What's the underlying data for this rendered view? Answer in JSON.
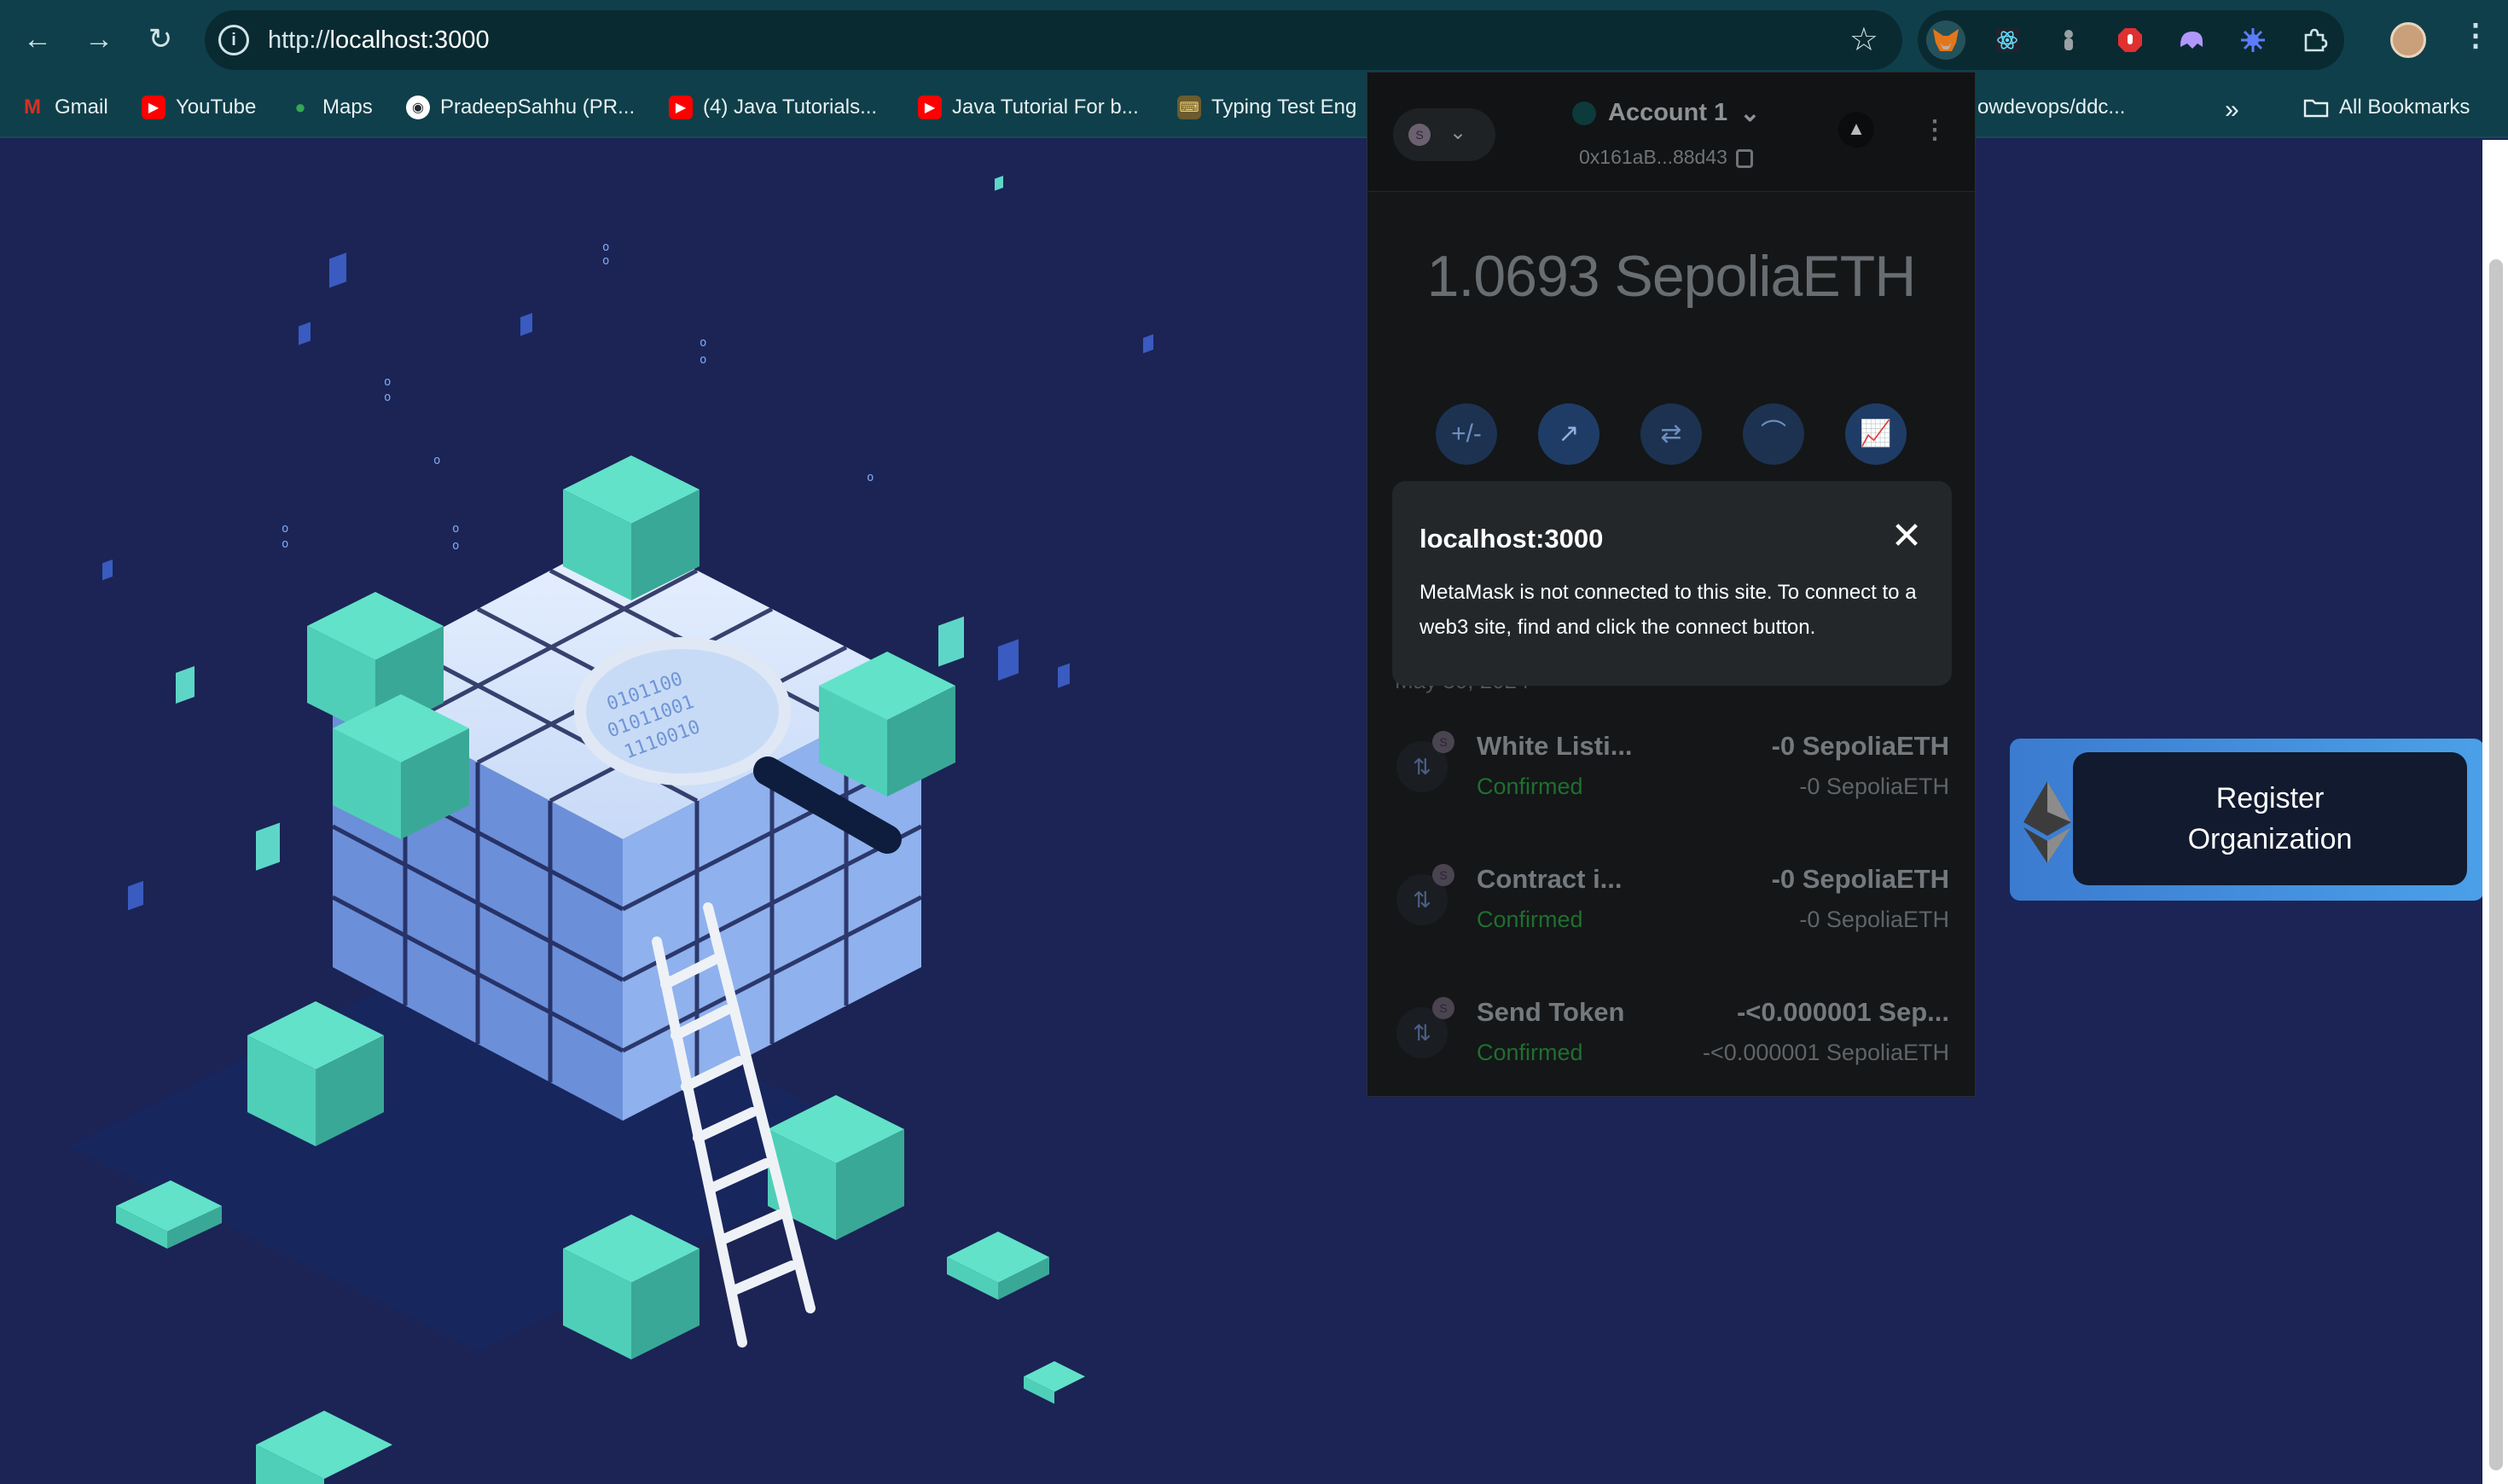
{
  "browser": {
    "url_prefix": "http://",
    "url_host": "localhost:3000",
    "back_icon": "←",
    "forward_icon": "→",
    "reload_icon": "↻",
    "star_icon": "☆",
    "more_icon": "⋮",
    "bookmarks": [
      {
        "label": "Gmail",
        "icon": "M",
        "color": "#d93025"
      },
      {
        "label": "YouTube",
        "icon": "▶",
        "color": "#ff0000"
      },
      {
        "label": "Maps",
        "icon": "●",
        "color": "#34a853"
      },
      {
        "label": "PradeepSahhu (PR...",
        "icon": "◉",
        "color": "#24292e"
      },
      {
        "label": "(4) Java Tutorials...",
        "icon": "▶",
        "color": "#ff0000"
      },
      {
        "label": "Java Tutorial For b...",
        "icon": "▶",
        "color": "#ff0000"
      },
      {
        "label": "Typing Test Eng",
        "icon": "⌨",
        "color": "#4a4a4a"
      },
      {
        "label": "owdevops/ddc...",
        "icon": "",
        "color": ""
      }
    ],
    "bookmarks_more": "»",
    "all_bookmarks": "All Bookmarks"
  },
  "metamask": {
    "network_badge": "S",
    "account_name": "Account 1",
    "account_chevron": "⌄",
    "address": "0x161aB...88d43",
    "balance": "1.0693 SepoliaETH",
    "actions": [
      {
        "name": "buy-sell",
        "glyph": "+/-"
      },
      {
        "name": "send",
        "glyph": "↗"
      },
      {
        "name": "swap",
        "glyph": "⇄"
      },
      {
        "name": "bridge",
        "glyph": "⌒"
      },
      {
        "name": "portfolio",
        "glyph": "📈"
      }
    ],
    "date_partial": "May 30, 2024",
    "transactions": [
      {
        "title": "White Listi...",
        "status": "Confirmed",
        "amount": "-0 SepoliaETH",
        "sub": "-0 SepoliaETH"
      },
      {
        "title": "Contract i...",
        "status": "Confirmed",
        "amount": "-0 SepoliaETH",
        "sub": "-0 SepoliaETH"
      },
      {
        "title": "Send Token",
        "status": "Confirmed",
        "amount": "-<0.000001 Sep...",
        "sub": "-<0.000001 SepoliaETH"
      }
    ],
    "popup": {
      "title": "localhost:3000",
      "body": "MetaMask is not connected to this site. To connect to a web3 site, find and click the connect button.",
      "close": "✕"
    }
  },
  "app": {
    "register_label_line1": "Register",
    "register_label_line2": "Organization"
  }
}
